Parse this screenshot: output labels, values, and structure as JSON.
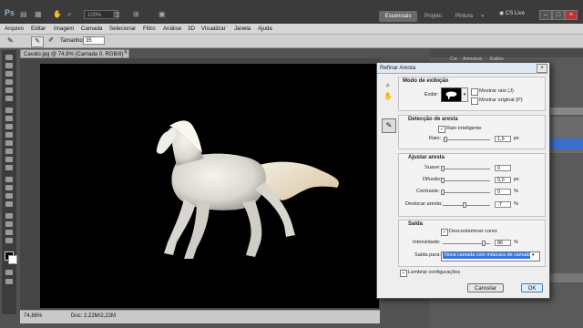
{
  "app": {
    "logo": "Ps",
    "zoom": "100%",
    "cs_live": "CS Live"
  },
  "workspaces": [
    {
      "label": "Essenciais"
    },
    {
      "label": "Projeto"
    },
    {
      "label": "Pintura"
    },
    {
      "label": "»"
    }
  ],
  "menu": [
    "Arquivo",
    "Editar",
    "Imagem",
    "Camada",
    "Selecionar",
    "Filtro",
    "Análise",
    "3D",
    "Visualizar",
    "Janela",
    "Ajuda"
  ],
  "options": {
    "size_label": "Tamanho:",
    "size_value": "35"
  },
  "document": {
    "tab_title": "Cavalo.jpg @ 74,9% (Camada 0, RGB/8) *",
    "tab_close": "×",
    "zoom_status": "74,86%",
    "doc_status": "Doc: 2,22M/2,22M"
  },
  "panels": {
    "tabs": [
      "Cor",
      "Amostras",
      "Estilos"
    ]
  },
  "dialog": {
    "title": "Refinar Aresta",
    "close": "×",
    "view_mode": {
      "title": "Modo de exibição",
      "view_label": "Exibir:",
      "show_radius": "Mostrar raio (J)",
      "show_original": "Mostrar original (P)"
    },
    "edge_detection": {
      "title": "Detecção de aresta",
      "smart_radius": "Raio inteligente",
      "radius_label": "Raio:",
      "radius_value": "1,9",
      "radius_unit": "px",
      "radius_level": 0.06
    },
    "adjust_edge": {
      "title": "Ajustar aresta",
      "rows": [
        {
          "label": "Suave:",
          "value": "0",
          "unit": "",
          "level": 0.0
        },
        {
          "label": "Difusão:",
          "value": "0,0",
          "unit": "px",
          "level": 0.0
        },
        {
          "label": "Contraste:",
          "value": "0",
          "unit": "%",
          "level": 0.0
        },
        {
          "label": "Deslocar aresta:",
          "value": "-7",
          "unit": "%",
          "level": 0.465
        }
      ]
    },
    "output": {
      "title": "Saída",
      "decontaminate": "Descontaminar cores",
      "intensity_label": "Intensidade:",
      "intensity_value": "86",
      "intensity_unit": "%",
      "intensity_level": 0.86,
      "output_to_label": "Saída para:",
      "output_to_value": "Nova camada com máscara de camada"
    },
    "remember": "Lembrar configurações",
    "cancel": "Cancelar",
    "ok": "OK"
  }
}
